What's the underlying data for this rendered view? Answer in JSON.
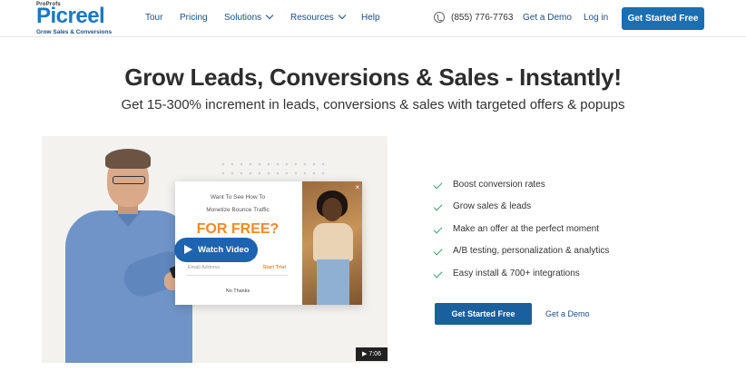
{
  "logo": {
    "brand": "ProProfs",
    "name": "Picreel",
    "tagline": "Grow Sales & Conversions"
  },
  "nav": {
    "tour": "Tour",
    "pricing": "Pricing",
    "solutions": "Solutions",
    "resources": "Resources",
    "help": "Help"
  },
  "header": {
    "phone": "(855) 776-7763",
    "demo": "Get a Demo",
    "login": "Log in",
    "cta": "Get Started Free"
  },
  "hero": {
    "title": "Grow Leads, Conversions & Sales - Instantly!",
    "subtitle": "Get 15-300% increment in leads, conversions & sales with targeted offers & popups"
  },
  "video": {
    "popup_line1": "Want To See How To",
    "popup_line2": "Monetize Bounce Traffic",
    "popup_offer": "FOR FREE?",
    "popup_input_placeholder": "Email Address",
    "popup_submit": "Start Trial",
    "popup_decline": "No Thanks",
    "watch_label": "Watch Video",
    "duration": "7:06"
  },
  "features": [
    "Boost conversion rates",
    "Grow sales & leads",
    "Make an offer at the perfect moment",
    "A/B testing, personalization & analytics",
    "Easy install & 700+ integrations"
  ],
  "cta": {
    "primary": "Get Started Free",
    "secondary": "Get a Demo"
  },
  "colors": {
    "brand_blue": "#1a78c2",
    "button_blue": "#1a6fb3",
    "check_green": "#3aa46b",
    "offer_orange": "#f08a2a"
  }
}
